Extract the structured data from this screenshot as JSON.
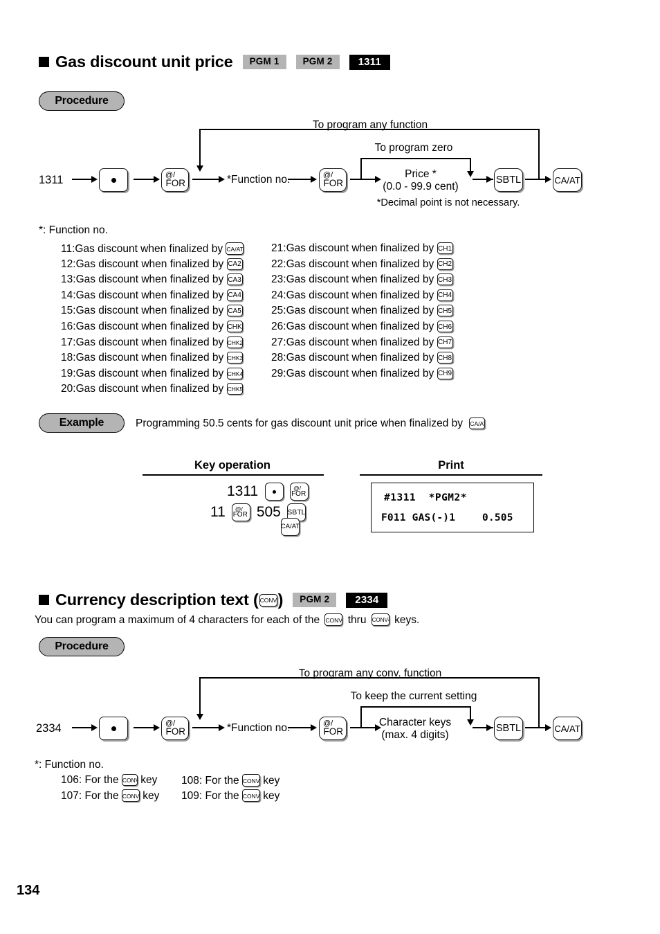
{
  "page": {
    "number": "134"
  },
  "section1": {
    "title": "Gas discount unit price",
    "badges": [
      {
        "label": "PGM 1",
        "style": "grey"
      },
      {
        "label": "PGM 2",
        "style": "grey"
      },
      {
        "label": "1311",
        "style": "black"
      }
    ],
    "procedure_label": "Procedure",
    "flow": {
      "start_code": "1311",
      "dot_key": "●",
      "for_key_line1": "@/",
      "for_key_line2": "FOR",
      "function_no": "*Function no.",
      "branch_top_label": "To program any function",
      "branch_mid_label": "To program zero",
      "price_line1": "Price *",
      "price_line2": "(0.0 - 99.9 cent)",
      "footnote": "*Decimal point is not necessary.",
      "sbtl_key": "SBTL",
      "caat_key": "CA/AT"
    },
    "function_note": "*: Function no.",
    "function_list_left": [
      {
        "no": "11:",
        "text": "Gas discount when finalized by",
        "key": "CA/AT"
      },
      {
        "no": "12:",
        "text": "Gas discount when finalized by",
        "key": "CA2"
      },
      {
        "no": "13:",
        "text": "Gas discount when finalized by",
        "key": "CA3"
      },
      {
        "no": "14:",
        "text": "Gas discount when finalized by",
        "key": "CA4"
      },
      {
        "no": "15:",
        "text": "Gas discount when finalized by",
        "key": "CA5"
      },
      {
        "no": "16:",
        "text": "Gas discount when finalized by",
        "key": "CHK"
      },
      {
        "no": "17:",
        "text": "Gas discount when finalized by",
        "key": "CHK2"
      },
      {
        "no": "18:",
        "text": "Gas discount when finalized by",
        "key": "CHK3"
      },
      {
        "no": "19:",
        "text": "Gas discount when finalized by",
        "key": "CHK4"
      },
      {
        "no": "20:",
        "text": "Gas discount when finalized by",
        "key": "CHK5"
      }
    ],
    "function_list_right": [
      {
        "no": "21:",
        "text": "Gas discount when finalized by",
        "key": "CH1"
      },
      {
        "no": "22:",
        "text": "Gas discount when finalized by",
        "key": "CH2"
      },
      {
        "no": "23:",
        "text": "Gas discount when finalized by",
        "key": "CH3"
      },
      {
        "no": "24:",
        "text": "Gas discount when finalized by",
        "key": "CH4"
      },
      {
        "no": "25:",
        "text": "Gas discount when finalized by",
        "key": "CH5"
      },
      {
        "no": "26:",
        "text": "Gas discount when finalized by",
        "key": "CH6"
      },
      {
        "no": "27:",
        "text": "Gas discount when finalized by",
        "key": "CH7"
      },
      {
        "no": "28:",
        "text": "Gas discount when finalized by",
        "key": "CH8"
      },
      {
        "no": "29:",
        "text": "Gas discount when finalized by",
        "key": "CH9"
      }
    ],
    "example": {
      "label": "Example",
      "text": "Programming 50.5 cents for gas discount unit price when finalized by",
      "text_key": "CA/AT",
      "col_keyop": "Key operation",
      "col_print": "Print",
      "keyop_row1_num": "1311",
      "keyop_row2_num1": "11",
      "keyop_row2_num2": "505",
      "print_line1": "#1311  *PGM2*",
      "print_line2_left": "F011 GAS(-)1",
      "print_line2_right": "0.505"
    }
  },
  "section2": {
    "title_pre": "Currency description text (",
    "title_key": "CONV",
    "title_post": ")",
    "badges": [
      {
        "label": "PGM 2",
        "style": "grey"
      },
      {
        "label": "2334",
        "style": "black"
      }
    ],
    "intro_pre": "You can program a maximum of 4 characters for each of the",
    "intro_key1": "CONV",
    "intro_mid": "thru",
    "intro_key2": "CONV4",
    "intro_post": "keys.",
    "procedure_label": "Procedure",
    "flow": {
      "start_code": "2334",
      "dot_key": "●",
      "for_key_line1": "@/",
      "for_key_line2": "FOR",
      "function_no": "*Function no.",
      "branch_top_label": "To program any conv. function",
      "branch_mid_label": "To keep the current setting",
      "char_line1": "Character keys",
      "char_line2": "(max. 4 digits)",
      "sbtl_key": "SBTL",
      "caat_key": "CA/AT"
    },
    "function_note": "*: Function no.",
    "function_list_left": [
      {
        "no": "106:",
        "pre": "For the",
        "key": "CONV",
        "post": "key"
      },
      {
        "no": "107:",
        "pre": "For the",
        "key": "CONV2",
        "post": "key"
      }
    ],
    "function_list_right": [
      {
        "no": "108:",
        "pre": "For the",
        "key": "CONV3",
        "post": "key"
      },
      {
        "no": "109:",
        "pre": "For the",
        "key": "CONV4",
        "post": "key"
      }
    ]
  }
}
